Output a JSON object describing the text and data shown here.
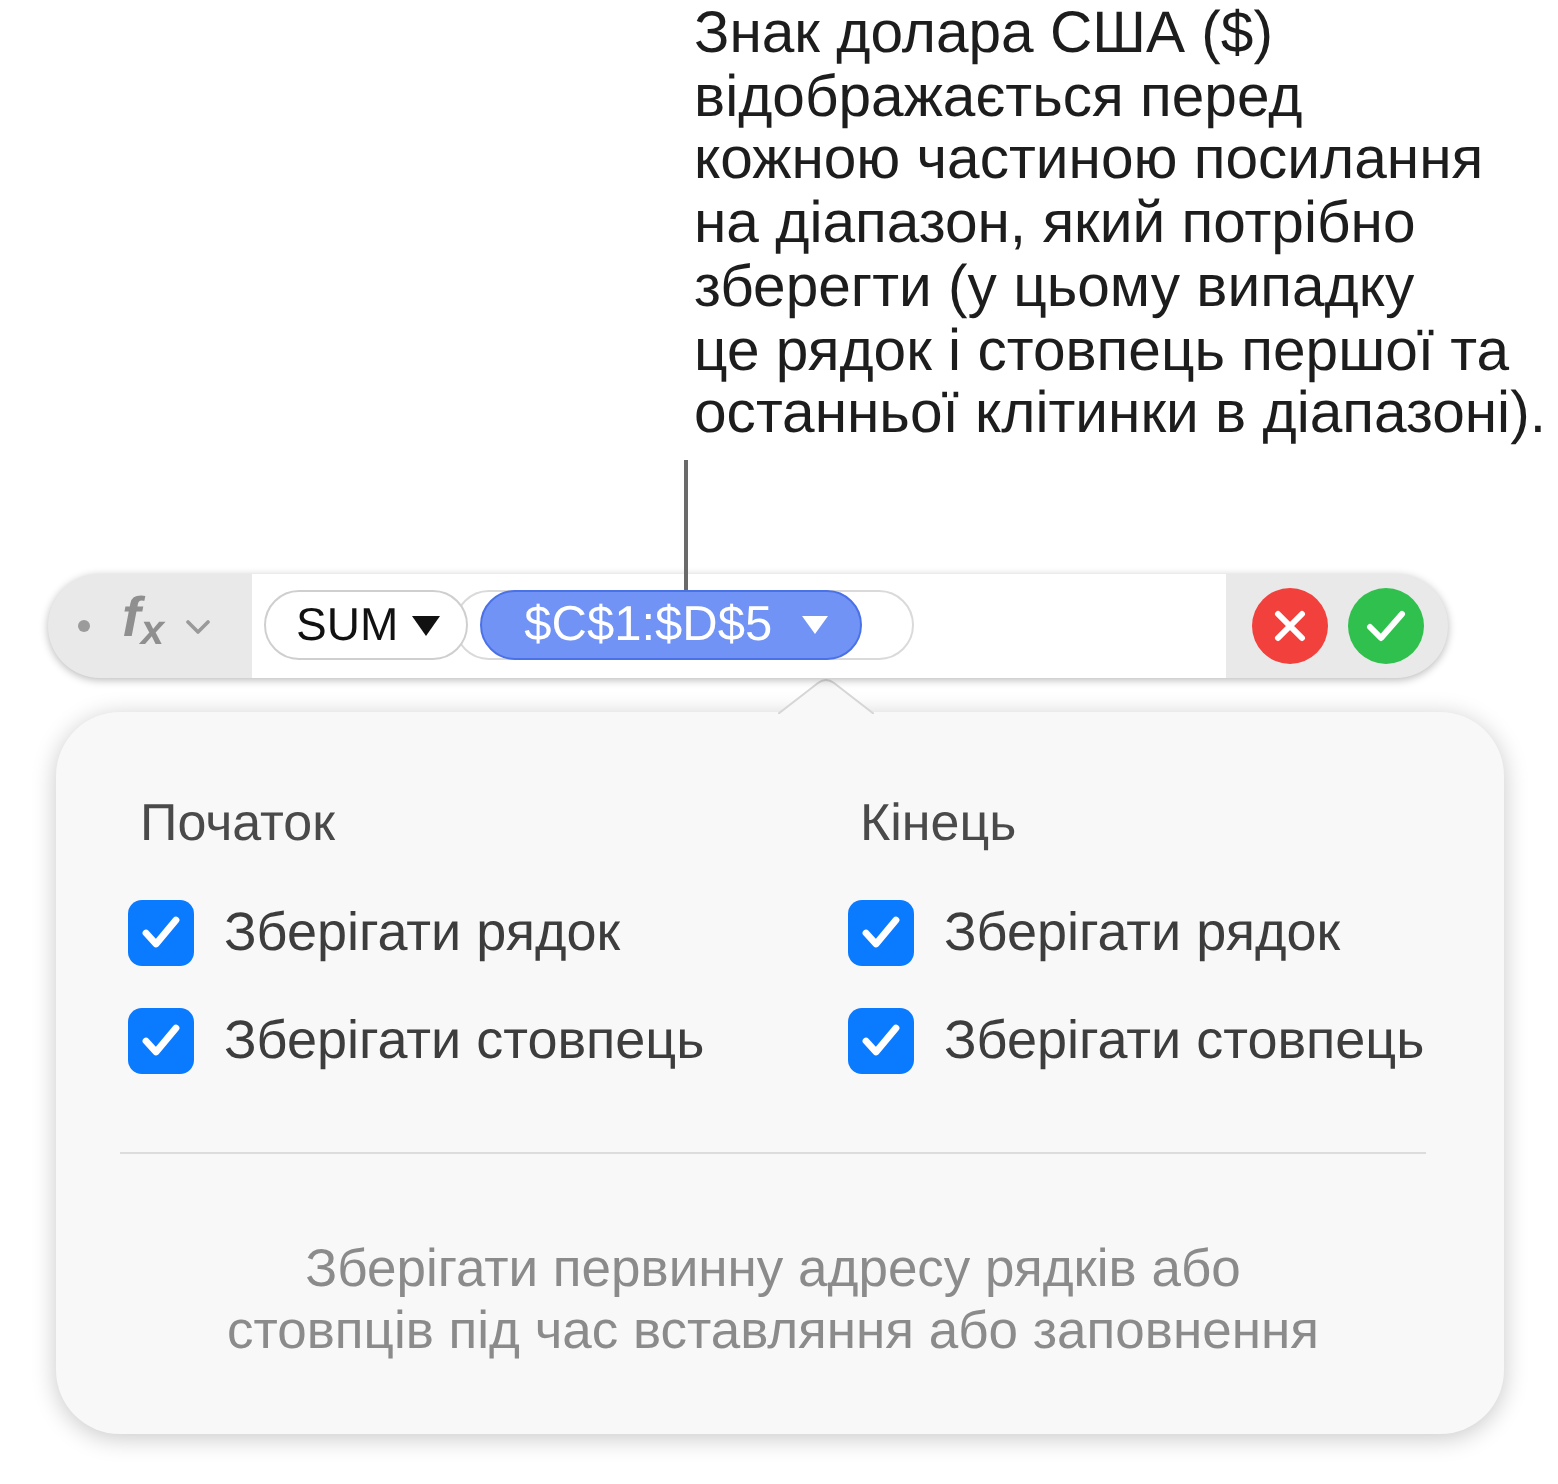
{
  "callout": {
    "text": "Знак долара США ($)\nвідображається перед\nкожною частиною посилання\nна діапазон, який потрібно\nзберегти (у цьому випадку\nце рядок і стовпець першої та\nостанньої клітинки в діапазоні)."
  },
  "formula_bar": {
    "function_symbol": "f$_{x}$",
    "function": {
      "label": "SUM"
    },
    "argument": {
      "label": "$C$1:$D$5",
      "selected": true
    }
  },
  "popover": {
    "columns": [
      {
        "heading": "Початок",
        "options": [
          {
            "label": "Зберігати рядок",
            "checked": true
          },
          {
            "label": "Зберігати стовпець",
            "checked": true
          }
        ]
      },
      {
        "heading": "Кінець",
        "options": [
          {
            "label": "Зберігати рядок",
            "checked": true
          },
          {
            "label": "Зберігати стовпець",
            "checked": true
          }
        ]
      }
    ],
    "footer": "Зберігати первинну адресу рядків або стовпців під час вставляння або заповнення"
  }
}
